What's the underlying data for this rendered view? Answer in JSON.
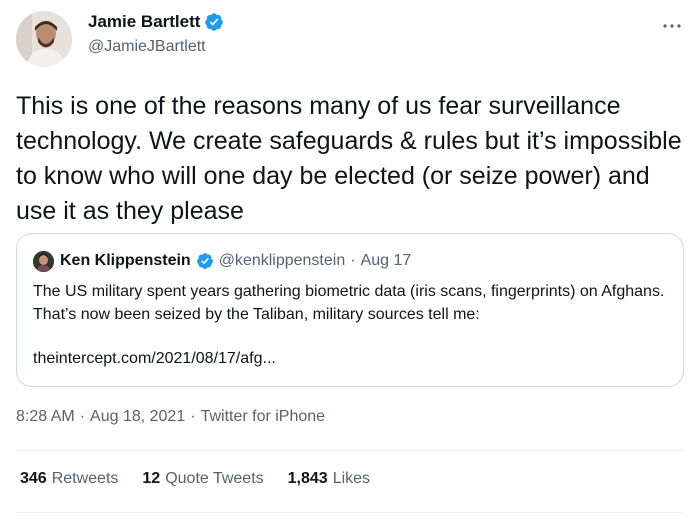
{
  "author": {
    "name": "Jamie Bartlett",
    "handle": "@JamieJBartlett",
    "verified": true
  },
  "tweet": {
    "text": "This is one of the reasons many of us fear surveillance technology. We create safeguards & rules but it’s impossible to know who will one day be elected (or seize power) and use it as they please"
  },
  "quoted": {
    "name": "Ken Klippenstein",
    "handle": "@kenklippenstein",
    "separator": "·",
    "date": "Aug 17",
    "text": "The US military spent years gathering biometric data (iris scans, fingerprints) on Afghans. That’s now been seized by the Taliban, military sources tell me:",
    "link": "theintercept.com/2021/08/17/afg..."
  },
  "meta": {
    "time": "8:28 AM",
    "sep1": "·",
    "date": "Aug 18, 2021",
    "sep2": "·",
    "source": "Twitter for iPhone"
  },
  "stats": {
    "retweets_count": "346",
    "retweets_label": "Retweets",
    "quotes_count": "12",
    "quotes_label": "Quote Tweets",
    "likes_count": "1,843",
    "likes_label": "Likes"
  },
  "colors": {
    "verified": "#1d9bf0",
    "secondary_text": "#536471",
    "border": "#cfd9de"
  },
  "icons": {
    "verified": "verified-badge-icon",
    "more": "more-options-icon"
  }
}
